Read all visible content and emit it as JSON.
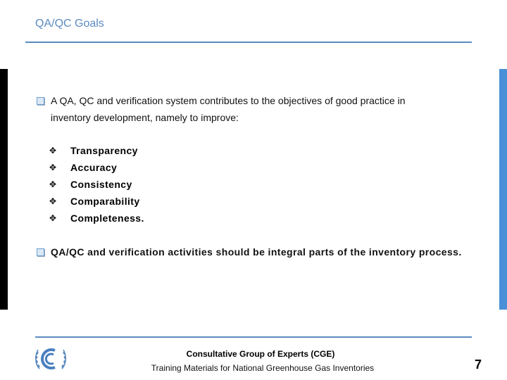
{
  "slide": {
    "title": "QA/QC Goals",
    "colors": {
      "accent": "#5b8bc0",
      "right_bar": "#4a90d9",
      "left_bar": "#000000"
    },
    "bullet1": {
      "icon": "checkbox-square-icon",
      "line1": "A QA, QC and verification system contributes to the objectives of good practice in",
      "line2": "inventory development, namely to improve:"
    },
    "sub_items": [
      {
        "icon": "four-diamond-icon",
        "glyph": "✥",
        "label": "Transparency"
      },
      {
        "icon": "four-diamond-icon",
        "glyph": "✥",
        "label": "Accuracy"
      },
      {
        "icon": "four-diamond-icon",
        "glyph": "✥",
        "label": "Consistency"
      },
      {
        "icon": "four-diamond-icon",
        "glyph": "✥",
        "label": "Comparability"
      },
      {
        "icon": "four-diamond-icon",
        "glyph": "✥",
        "label": "Completeness."
      }
    ],
    "bullet2": {
      "icon": "checkbox-square-icon",
      "text": "QA/QC and verification activities should be integral parts of the inventory process."
    }
  },
  "footer": {
    "logo": "unfccc-logo",
    "organization": "Consultative Group of Experts (CGE)",
    "subtitle": "Training Materials for National Greenhouse Gas Inventories",
    "page_number": "7"
  }
}
